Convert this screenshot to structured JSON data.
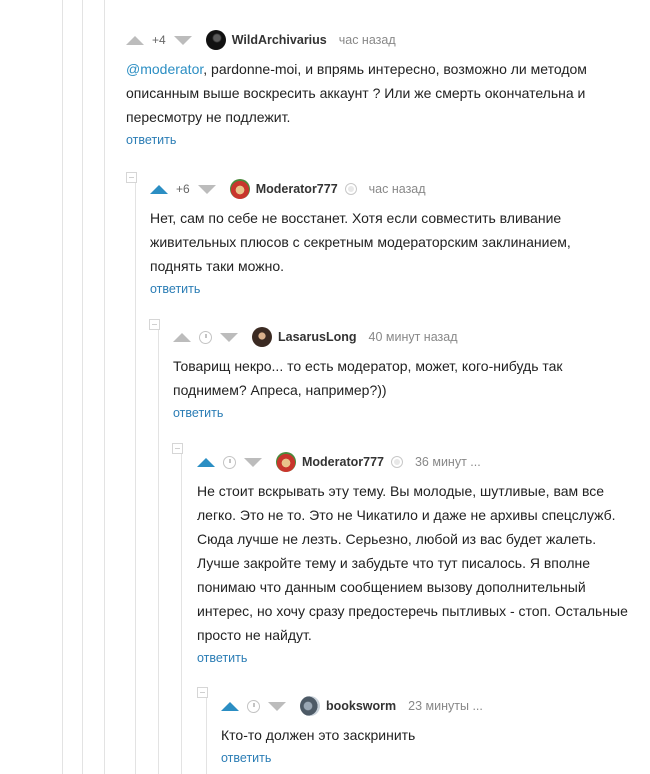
{
  "comments": [
    {
      "rating": "+4",
      "author": "WildArchivarius",
      "time": "час назад",
      "mention": "@moderator",
      "text": ", pardonne-moi, и впрямь интересно, возможно ли методом описанным выше воскресить аккаунт ? Или же смерть окончательна и пересмотру не подлежит.",
      "reply": "ответить"
    },
    {
      "rating": "+6",
      "author": "Moderator777",
      "time": "час назад",
      "text": "Нет, сам по себе не восстанет. Хотя если совместить вливание живительных плюсов с секретным модераторским заклинанием, поднять таки можно.",
      "reply": "ответить"
    },
    {
      "author": "LasarusLong",
      "time": "40 минут назад",
      "text": "Товарищ некро... то есть модератор, может, кого-нибудь так поднимем? Апреса, например?))",
      "reply": "ответить"
    },
    {
      "author": "Moderator777",
      "time": "36 минут ...",
      "text": "Не стоит вскрывать эту тему. Вы молодые, шутливые, вам все легко. Это не то. Это не Чикатило и даже не архивы спецслужб. Сюда лучше не лезть. Серьезно, любой из вас будет жалеть. Лучше закройте тему и забудьте что тут писалось. Я вполне понимаю что данным сообщением вызову дополнительный интерес, но хочу сразу предостеречь пытливых - стоп. Остальные просто не найдут.",
      "reply": "ответить"
    },
    {
      "author": "booksworm",
      "time": "23 минуты ...",
      "text": "Кто-то должен это заскринить",
      "reply": "ответить"
    }
  ],
  "colors": {
    "accent": "#2b8ec3",
    "link": "#2b7db5"
  },
  "icons": [
    "upvote-arrow-icon",
    "downvote-arrow-icon",
    "clock-icon",
    "moderator-icon",
    "collapse-icon"
  ]
}
